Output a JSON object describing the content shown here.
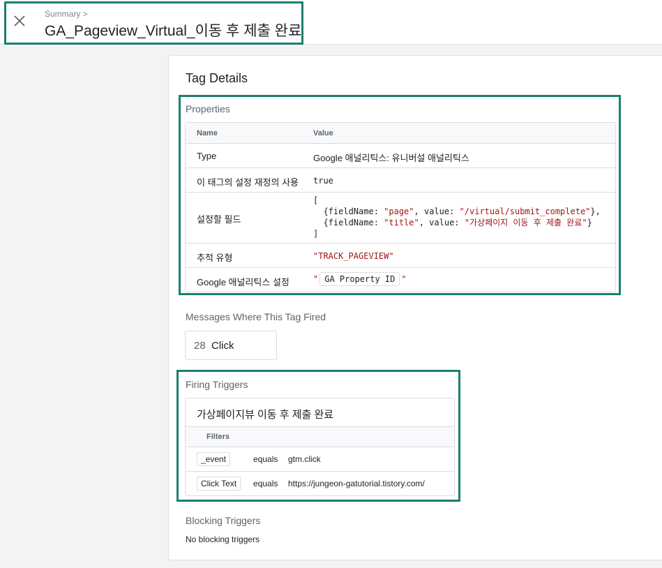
{
  "header": {
    "breadcrumb": "Summary >",
    "title": "GA_Pageview_Virtual_이동 후 제출 완료"
  },
  "card": {
    "title": "Tag Details"
  },
  "properties": {
    "section_label": "Properties",
    "col_name": "Name",
    "col_value": "Value",
    "rows": [
      {
        "name": "Type",
        "value": "Google 애널리틱스: 유니버설 애널리틱스"
      },
      {
        "name": "이 태그의 설정 재정의 사용",
        "value": "true"
      },
      {
        "name": "설정할 필드",
        "value_lines": [
          "[",
          "  {fieldName: ",
          "\"page\"",
          ", value: ",
          "\"/virtual/submit_complete\"",
          "},",
          "  {fieldName: ",
          "\"title\"",
          ", value: ",
          "\"가상페이지 이동 후 제출 완료\"",
          "}",
          "]"
        ]
      },
      {
        "name": "추적 유형",
        "value": "\"TRACK_PAGEVIEW\""
      },
      {
        "name": "Google 애널리틱스 설정",
        "value_prefix": "\"",
        "value_chip": "GA Property ID",
        "value_suffix": "\""
      }
    ]
  },
  "messages": {
    "section_label": "Messages Where This Tag Fired",
    "count": "28",
    "label": "Click"
  },
  "firing": {
    "section_label": "Firing Triggers",
    "trigger_name": "가상페이지뷰 이동 후 제출 완료",
    "filters_label": "Filters",
    "filters": [
      {
        "variable": "_event",
        "operator": "equals",
        "value": "gtm.click"
      },
      {
        "variable": "Click Text",
        "operator": "equals",
        "value": "https://jungeon-gatutorial.tistory.com/"
      }
    ]
  },
  "blocking": {
    "section_label": "Blocking Triggers",
    "empty_text": "No blocking triggers"
  },
  "colors": {
    "highlight": "#1b7f6e",
    "string": "#a31515"
  },
  "icons": {
    "close": "close-icon"
  }
}
